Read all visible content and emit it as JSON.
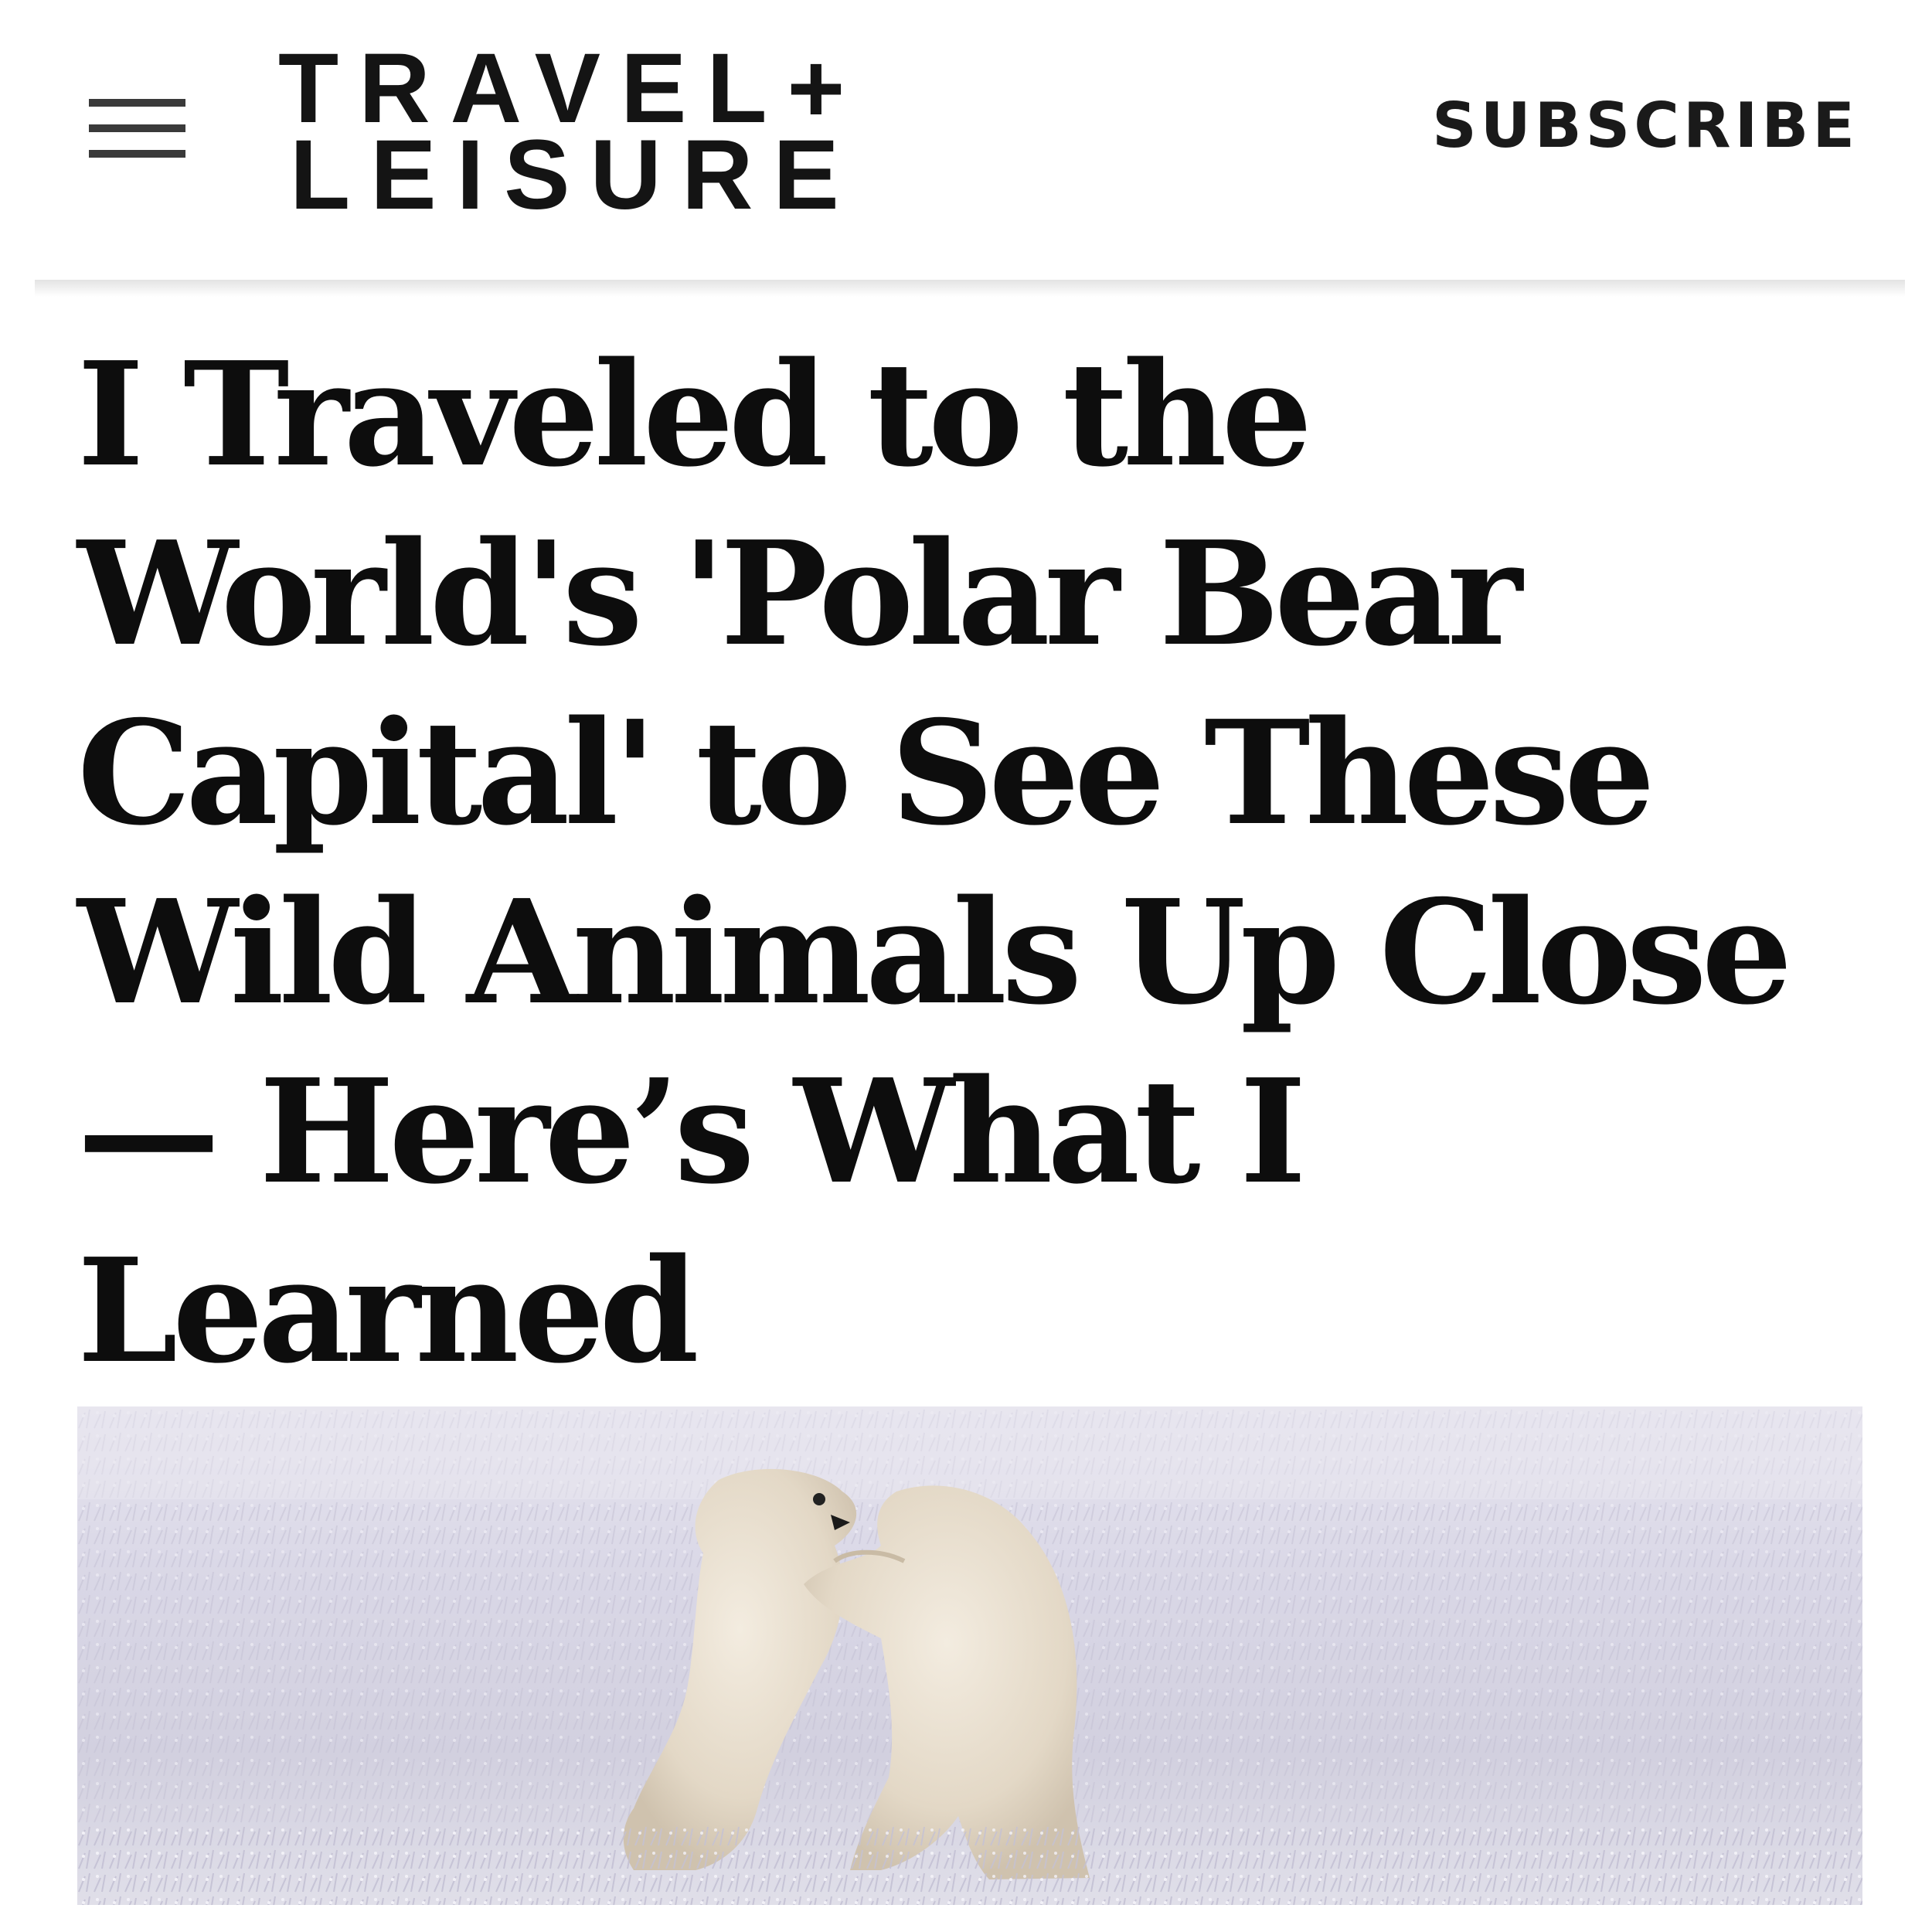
{
  "header": {
    "menu_icon": "hamburger-menu-icon",
    "logo": {
      "line1": "TRAVEL+",
      "line2": "LEISURE"
    },
    "subscribe_label": "SUBSCRIBE"
  },
  "article": {
    "headline": "I Traveled to the World's 'Polar Bear Capital' to See These Wild Animals Up Close — Here’s What I Learned"
  },
  "hero_image": {
    "subject": "two-polar-bears-sparring-in-frosty-grass"
  },
  "colors": {
    "text": "#0d0d0d",
    "menu_icon": "#3a3a3a",
    "divider": "#e3e3e3",
    "background": "#ffffff"
  }
}
